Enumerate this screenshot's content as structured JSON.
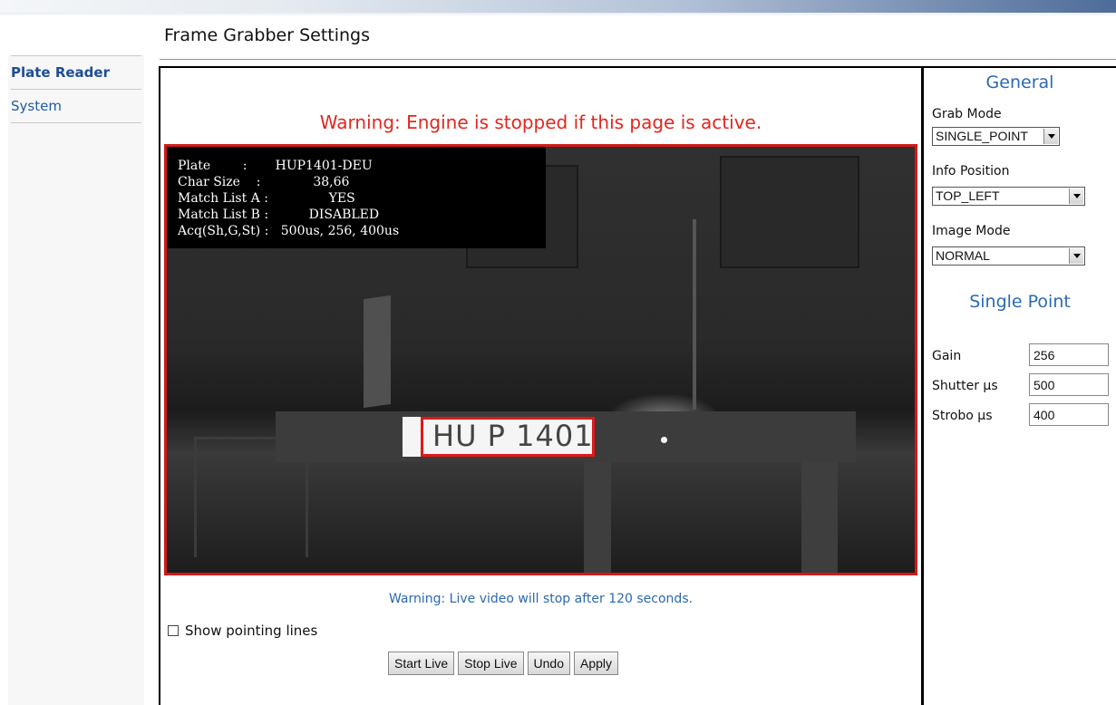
{
  "page": {
    "title": "Frame Grabber Settings"
  },
  "sidebar": {
    "items": [
      {
        "label": "Plate Reader"
      },
      {
        "label": "System"
      }
    ]
  },
  "main": {
    "warning_top": "Warning: Engine is stopped if this page is active.",
    "video": {
      "overlay_lines": [
        "Plate        :       HUP1401-DEU",
        "Char Size    :             38,66",
        "Match List A :               YES",
        "Match List B :          DISABLED",
        "Acq(Sh,G,St) :   500us, 256, 400us"
      ],
      "plate_text": "HU P 1401"
    },
    "warning_bottom": "Warning: Live video will stop after 120 seconds.",
    "pointing_lines": {
      "label": "Show pointing lines",
      "checked": false
    },
    "buttons": {
      "start": "Start Live",
      "stop": "Stop Live",
      "undo": "Undo",
      "apply": "Apply"
    }
  },
  "right": {
    "general_heading": "General",
    "grab_mode": {
      "label": "Grab Mode",
      "value": "SINGLE_POINT"
    },
    "info_position": {
      "label": "Info Position",
      "value": "TOP_LEFT"
    },
    "image_mode": {
      "label": "Image Mode",
      "value": "NORMAL"
    },
    "single_point_heading": "Single Point",
    "gain": {
      "label": "Gain",
      "value": "256"
    },
    "shutter": {
      "label": "Shutter µs",
      "value": "500"
    },
    "strobo": {
      "label": "Strobo µs",
      "value": "400"
    }
  },
  "colors": {
    "warning_red": "#e3261d",
    "link_blue": "#1f5aa8",
    "heading_blue": "#2b6ab1",
    "detection_red": "#d01a1a"
  }
}
